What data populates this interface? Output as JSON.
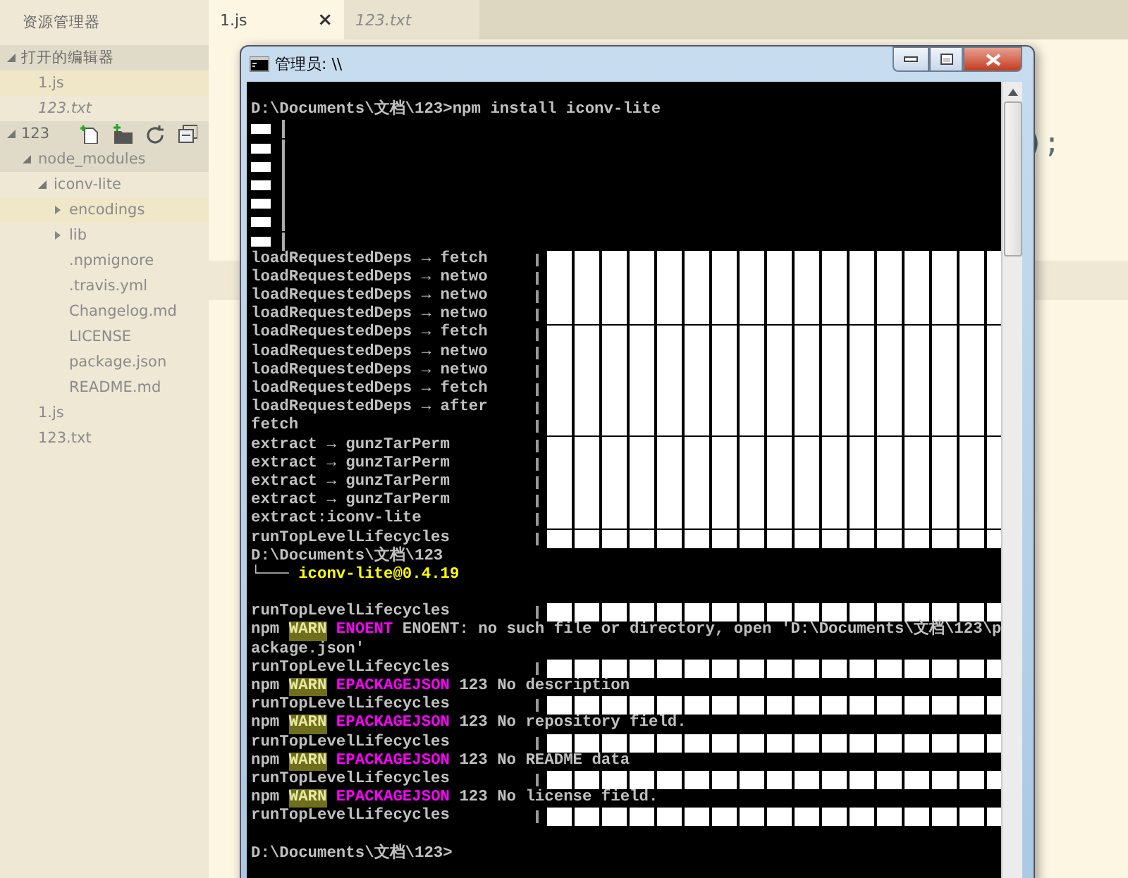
{
  "sidebar": {
    "title": "资源管理器",
    "sections": [
      {
        "label": "打开的编辑器",
        "expanded": true,
        "tools": false,
        "items": [
          {
            "label": "1.js",
            "italic": false,
            "selected": true,
            "focused": false
          },
          {
            "label": "123.txt",
            "italic": true,
            "selected": false,
            "focused": false
          }
        ]
      },
      {
        "label": "123",
        "expanded": true,
        "tools": true,
        "tree": [
          {
            "label": "node_modules",
            "folder": true,
            "expanded": true,
            "selected": false,
            "focused": true,
            "children": [
              {
                "label": "iconv-lite",
                "folder": true,
                "expanded": true,
                "selected": false,
                "focused": false,
                "children": [
                  {
                    "label": "encodings",
                    "folder": true,
                    "expanded": false,
                    "selected": true,
                    "focused": false
                  },
                  {
                    "label": "lib",
                    "folder": true,
                    "expanded": false,
                    "selected": false,
                    "focused": false
                  },
                  {
                    "label": ".npmignore",
                    "folder": false,
                    "selected": false,
                    "focused": false
                  },
                  {
                    "label": ".travis.yml",
                    "folder": false,
                    "selected": false,
                    "focused": false
                  },
                  {
                    "label": "Changelog.md",
                    "folder": false,
                    "selected": false,
                    "focused": false
                  },
                  {
                    "label": "LICENSE",
                    "folder": false,
                    "selected": false,
                    "focused": false
                  },
                  {
                    "label": "package.json",
                    "folder": false,
                    "selected": false,
                    "focused": false
                  },
                  {
                    "label": "README.md",
                    "folder": false,
                    "selected": false,
                    "focused": false
                  }
                ]
              }
            ]
          },
          {
            "label": "1.js",
            "folder": false,
            "selected": false,
            "focused": false
          },
          {
            "label": "123.txt",
            "folder": false,
            "selected": false,
            "focused": false
          }
        ]
      }
    ]
  },
  "tabs": [
    {
      "label": "1.js",
      "italic": false,
      "selected": true,
      "close": "×"
    },
    {
      "label": "123.txt",
      "italic": true,
      "selected": false
    }
  ],
  "editor": {
    "code": ");",
    "current_line_highlight": true
  },
  "console": {
    "title": "管理员: \\\\",
    "lines": [
      {
        "kind": "blank"
      },
      {
        "kind": "text",
        "glyph_bar": false,
        "parts": [
          {
            "kind": "plain",
            "text": "D:\\Documents\\文档\\123>npm install iconv-lite"
          }
        ]
      },
      {
        "kind": "glyphs"
      },
      {
        "kind": "glyphs"
      },
      {
        "kind": "glyphs"
      },
      {
        "kind": "glyphs"
      },
      {
        "kind": "glyphs"
      },
      {
        "kind": "glyphs"
      },
      {
        "kind": "glyphs"
      },
      {
        "kind": "text",
        "glyph_bar": true,
        "parts": [
          {
            "kind": "plain",
            "text": "loadRequestedDeps → fetch"
          }
        ]
      },
      {
        "kind": "text",
        "glyph_bar": true,
        "parts": [
          {
            "kind": "plain",
            "text": "loadRequestedDeps → netwo"
          }
        ]
      },
      {
        "kind": "text",
        "glyph_bar": true,
        "parts": [
          {
            "kind": "plain",
            "text": "loadRequestedDeps → netwo"
          }
        ]
      },
      {
        "kind": "text",
        "glyph_bar": true,
        "parts": [
          {
            "kind": "plain",
            "text": "loadRequestedDeps → netwo"
          }
        ]
      },
      {
        "kind": "text",
        "glyph_bar": true,
        "parts": [
          {
            "kind": "plain",
            "text": "loadRequestedDeps → fetch"
          }
        ]
      },
      {
        "kind": "text",
        "glyph_bar": true,
        "parts": [
          {
            "kind": "plain",
            "text": "loadRequestedDeps → netwo"
          }
        ]
      },
      {
        "kind": "text",
        "glyph_bar": true,
        "parts": [
          {
            "kind": "plain",
            "text": "loadRequestedDeps → netwo"
          }
        ]
      },
      {
        "kind": "text",
        "glyph_bar": true,
        "parts": [
          {
            "kind": "plain",
            "text": "loadRequestedDeps → fetch"
          }
        ]
      },
      {
        "kind": "text",
        "glyph_bar": true,
        "parts": [
          {
            "kind": "plain",
            "text": "loadRequestedDeps → after"
          }
        ]
      },
      {
        "kind": "text",
        "glyph_bar": true,
        "parts": [
          {
            "kind": "plain",
            "text": "fetch"
          }
        ]
      },
      {
        "kind": "text",
        "glyph_bar": true,
        "parts": [
          {
            "kind": "plain",
            "text": "extract → gunzTarPerm"
          }
        ]
      },
      {
        "kind": "text",
        "glyph_bar": true,
        "parts": [
          {
            "kind": "plain",
            "text": "extract → gunzTarPerm"
          }
        ]
      },
      {
        "kind": "text",
        "glyph_bar": true,
        "parts": [
          {
            "kind": "plain",
            "text": "extract → gunzTarPerm"
          }
        ]
      },
      {
        "kind": "text",
        "glyph_bar": true,
        "parts": [
          {
            "kind": "plain",
            "text": "extract → gunzTarPerm"
          }
        ]
      },
      {
        "kind": "text",
        "glyph_bar": true,
        "parts": [
          {
            "kind": "plain",
            "text": "extract:iconv-lite"
          }
        ]
      },
      {
        "kind": "text",
        "glyph_bar": true,
        "parts": [
          {
            "kind": "plain",
            "text": "runTopLevelLifecycles"
          }
        ]
      },
      {
        "kind": "text",
        "glyph_bar": false,
        "parts": [
          {
            "kind": "plain",
            "text": "D:\\Documents\\文档\\123"
          }
        ]
      },
      {
        "kind": "text",
        "glyph_bar": false,
        "parts": [
          {
            "kind": "plain",
            "text": "└─── "
          },
          {
            "kind": "version",
            "text": "iconv-lite@0.4.19"
          }
        ]
      },
      {
        "kind": "blank"
      },
      {
        "kind": "text",
        "glyph_bar": true,
        "parts": [
          {
            "kind": "plain",
            "text": "runTopLevelLifecycles"
          }
        ]
      },
      {
        "kind": "text",
        "glyph_bar": false,
        "parts": [
          {
            "kind": "plain",
            "text": "npm "
          },
          {
            "kind": "warn",
            "text": "WARN"
          },
          {
            "kind": "code",
            "text": " ENOENT"
          },
          {
            "kind": "plain",
            "text": " ENOENT: no such file or directory, open 'D:\\Documents\\文档\\123\\p"
          }
        ]
      },
      {
        "kind": "text",
        "glyph_bar": false,
        "parts": [
          {
            "kind": "plain",
            "text": "ackage.json'"
          }
        ]
      },
      {
        "kind": "text",
        "glyph_bar": true,
        "parts": [
          {
            "kind": "plain",
            "text": "runTopLevelLifecycles"
          }
        ]
      },
      {
        "kind": "text",
        "glyph_bar": false,
        "parts": [
          {
            "kind": "plain",
            "text": "npm "
          },
          {
            "kind": "warn",
            "text": "WARN"
          },
          {
            "kind": "code",
            "text": " EPACKAGEJSON"
          },
          {
            "kind": "plain",
            "text": " 123 No description"
          }
        ]
      },
      {
        "kind": "text",
        "glyph_bar": true,
        "parts": [
          {
            "kind": "plain",
            "text": "runTopLevelLifecycles"
          }
        ]
      },
      {
        "kind": "text",
        "glyph_bar": false,
        "parts": [
          {
            "kind": "plain",
            "text": "npm "
          },
          {
            "kind": "warn",
            "text": "WARN"
          },
          {
            "kind": "code",
            "text": " EPACKAGEJSON"
          },
          {
            "kind": "plain",
            "text": " 123 No repository field."
          }
        ]
      },
      {
        "kind": "text",
        "glyph_bar": true,
        "parts": [
          {
            "kind": "plain",
            "text": "runTopLevelLifecycles"
          }
        ]
      },
      {
        "kind": "text",
        "glyph_bar": false,
        "parts": [
          {
            "kind": "plain",
            "text": "npm "
          },
          {
            "kind": "warn",
            "text": "WARN"
          },
          {
            "kind": "code",
            "text": " EPACKAGEJSON"
          },
          {
            "kind": "plain",
            "text": " 123 No README data"
          }
        ]
      },
      {
        "kind": "text",
        "glyph_bar": true,
        "parts": [
          {
            "kind": "plain",
            "text": "runTopLevelLifecycles"
          }
        ]
      },
      {
        "kind": "text",
        "glyph_bar": false,
        "parts": [
          {
            "kind": "plain",
            "text": "npm "
          },
          {
            "kind": "warn",
            "text": "WARN"
          },
          {
            "kind": "code",
            "text": " EPACKAGEJSON"
          },
          {
            "kind": "plain",
            "text": " 123 No license field."
          }
        ]
      },
      {
        "kind": "text",
        "glyph_bar": true,
        "parts": [
          {
            "kind": "plain",
            "text": "runTopLevelLifecycles"
          }
        ]
      },
      {
        "kind": "blank"
      },
      {
        "kind": "text",
        "glyph_bar": false,
        "parts": [
          {
            "kind": "plain",
            "text": "D:\\Documents\\文档\\123>"
          }
        ]
      }
    ]
  }
}
